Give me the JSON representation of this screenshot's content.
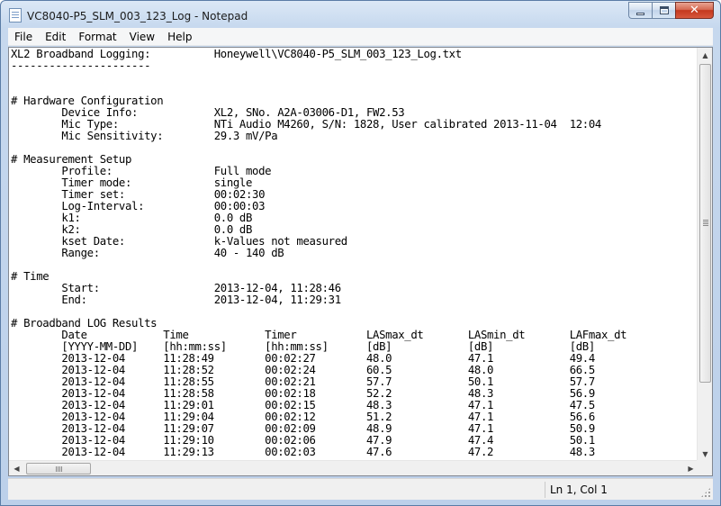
{
  "window": {
    "title": "VC8040-P5_SLM_003_123_Log - Notepad",
    "minimize_icon": "minimize-icon",
    "maximize_icon": "maximize-icon",
    "close_glyph": "✕"
  },
  "menu": [
    "File",
    "Edit",
    "Format",
    "View",
    "Help"
  ],
  "document": {
    "lines": [
      "XL2 Broadband Logging:          Honeywell\\VC8040-P5_SLM_003_123_Log.txt",
      "----------------------",
      "",
      "",
      "# Hardware Configuration",
      "        Device Info:            XL2, SNo. A2A-03006-D1, FW2.53",
      "        Mic Type:               NTi Audio M4260, S/N: 1828, User calibrated 2013-11-04  12:04",
      "        Mic Sensitivity:        29.3 mV/Pa",
      "",
      "# Measurement Setup",
      "        Profile:                Full mode",
      "        Timer mode:             single",
      "        Timer set:              00:02:30",
      "        Log-Interval:           00:00:03",
      "        k1:                     0.0 dB",
      "        k2:                     0.0 dB",
      "        kset Date:              k-Values not measured",
      "        Range:                  40 - 140 dB",
      "",
      "# Time",
      "        Start:                  2013-12-04, 11:28:46",
      "        End:                    2013-12-04, 11:29:31",
      "",
      "# Broadband LOG Results",
      "        Date            Time            Timer           LASmax_dt       LASmin_dt       LAFmax_dt",
      "        [YYYY-MM-DD]    [hh:mm:ss]      [hh:mm:ss]      [dB]            [dB]            [dB]",
      "        2013-12-04      11:28:49        00:02:27        48.0            47.1            49.4",
      "        2013-12-04      11:28:52        00:02:24        60.5            48.0            66.5",
      "        2013-12-04      11:28:55        00:02:21        57.7            50.1            57.7",
      "        2013-12-04      11:28:58        00:02:18        52.2            48.3            56.9",
      "        2013-12-04      11:29:01        00:02:15        48.3            47.1            47.5",
      "        2013-12-04      11:29:04        00:02:12        51.2            47.1            56.6",
      "        2013-12-04      11:29:07        00:02:09        48.9            47.1            50.9",
      "        2013-12-04      11:29:10        00:02:06        47.9            47.4            50.1",
      "        2013-12-04      11:29:13        00:02:03        47.6            47.2            48.3"
    ]
  },
  "status": {
    "position": "Ln 1, Col 1"
  }
}
